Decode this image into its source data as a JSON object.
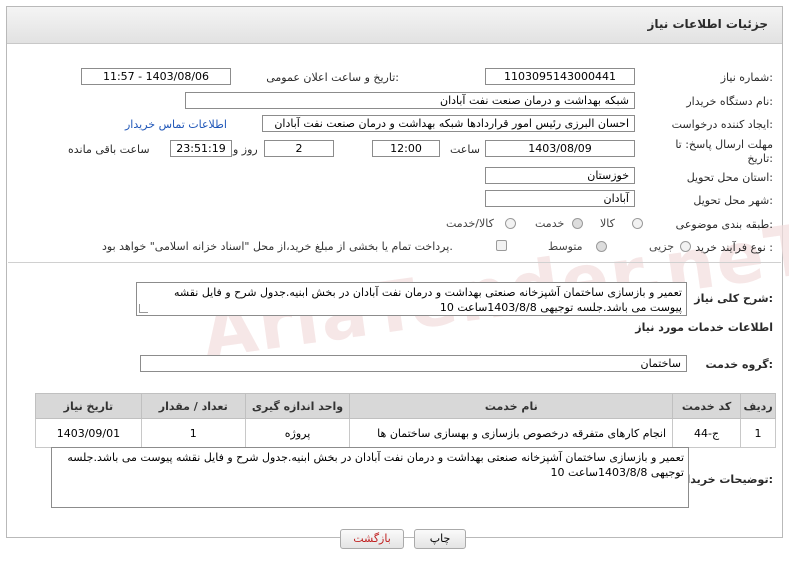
{
  "header": {
    "title": "جزئیات اطلاعات نیاز"
  },
  "form": {
    "need_number": {
      "label": "شماره نیاز:",
      "value": "1103095143000441"
    },
    "announce_datetime": {
      "label": "تاریخ و ساعت اعلان عمومی:",
      "value": "1403/08/06 - 11:57"
    },
    "buyer_org": {
      "label": "نام دستگاه خریدار:",
      "value": "شبکه بهداشت و درمان صنعت نفت آبادان"
    },
    "requester": {
      "label": "ایجاد کننده درخواست:",
      "value": "احسان البرزی رئیس امور قراردادها شبکه بهداشت و درمان صنعت نفت آبادان",
      "contact_link": "اطلاعات تماس خریدار"
    },
    "deadline": {
      "label": "مهلت ارسال پاسخ: تا تاریخ:",
      "date": "1403/08/09",
      "time_label": "ساعت",
      "time": "12:00",
      "days": "2",
      "days_label": "روز و",
      "remaining": "23:51:19",
      "remaining_label": "ساعت باقی مانده"
    },
    "province": {
      "label": "استان محل تحویل:",
      "value": "خوزستان"
    },
    "city": {
      "label": "شهر محل تحویل:",
      "value": "آبادان"
    },
    "category": {
      "label": "طبقه بندی موضوعی:",
      "options": [
        "کالا",
        "خدمت",
        "کالا/خدمت"
      ],
      "selected": "خدمت"
    },
    "purchase_type": {
      "label": "نوع فرآیند خرید :",
      "options": [
        "جزیی",
        "متوسط"
      ],
      "selected": "متوسط",
      "treasury_note": "پرداخت تمام یا بخشی از مبلغ خرید،از محل \"اسناد خزانه اسلامی\" خواهد بود."
    }
  },
  "summary": {
    "label": "شرح کلی نیاز:",
    "text": "تعمیر و بازسازی ساختمان آشپزخانه صنعتی بهداشت و درمان نفت آبادان در بخش ابنیه.جدول شرح و فایل نقشه پیوست می باشد.جلسه توجیهی 1403/8/8ساعت 10"
  },
  "services_section": {
    "title": "اطلاعات خدمات مورد نیاز",
    "group_label": "گروه خدمت:",
    "group_value": "ساختمان"
  },
  "table": {
    "headers": [
      "ردیف",
      "کد خدمت",
      "نام خدمت",
      "واحد اندازه گیری",
      "تعداد / مقدار",
      "تاریخ نیاز"
    ],
    "rows": [
      [
        "1",
        "ج-44",
        "انجام کارهای متفرقه درخصوص بازسازی و بهسازی ساختمان ها",
        "پروژه",
        "1",
        "1403/09/01"
      ]
    ]
  },
  "buyer_notes": {
    "label": "توضیحات خریدار:",
    "text": "تعمیر و بازسازی ساختمان آشپزخانه صنعتی بهداشت و درمان نفت آبادان در بخش ابنیه.جدول شرح و فایل نقشه پیوست می باشد.جلسه توجیهی 1403/8/8ساعت 10"
  },
  "buttons": {
    "print": "چاپ",
    "back": "بازگشت"
  },
  "watermark": "AriaTender.neT"
}
